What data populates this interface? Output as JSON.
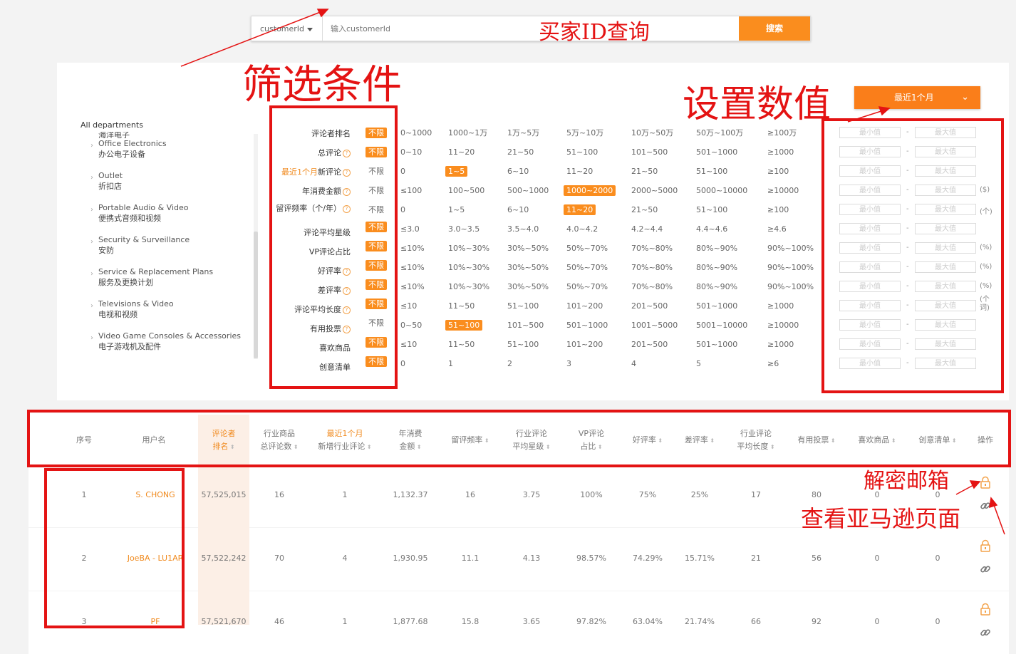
{
  "search": {
    "field_select": "customerId",
    "placeholder": "输入customerId",
    "button": "搜索"
  },
  "departments": {
    "title": "All departments",
    "partial_item": "海洋电子",
    "items": [
      {
        "en": "Office Electronics",
        "zh": "办公电子设备"
      },
      {
        "en": "Outlet",
        "zh": "折扣店"
      },
      {
        "en": "Portable Audio & Video",
        "zh": "便携式音频和视频"
      },
      {
        "en": "Security & Surveillance",
        "zh": "安防"
      },
      {
        "en": "Service & Replacement Plans",
        "zh": "服务及更换计划"
      },
      {
        "en": "Televisions & Video",
        "zh": "电视和视频"
      },
      {
        "en": "Video Game Consoles & Accessories",
        "zh": "电子游戏机及配件"
      }
    ]
  },
  "period_button": "最近1个月",
  "filters": [
    {
      "label": "评论者排名",
      "help": false,
      "nolimit": "不限",
      "nolimit_active": true,
      "options": [
        "0~1000",
        "1000~1万",
        "1万~5万",
        "5万~10万",
        "10万~50万",
        "50万~100万",
        "≥100万"
      ],
      "active": -1,
      "unit": ""
    },
    {
      "label": "总评论",
      "help": true,
      "nolimit": "不限",
      "nolimit_active": true,
      "options": [
        "0~10",
        "11~20",
        "21~50",
        "51~100",
        "101~500",
        "501~1000",
        "≥1000"
      ],
      "active": -1,
      "unit": ""
    },
    {
      "label_prefix": "最近1个月",
      "label": "新评论",
      "help": true,
      "nolimit": "不限",
      "nolimit_active": false,
      "options": [
        "0",
        "1~5",
        "6~10",
        "11~20",
        "21~50",
        "51~100",
        "≥100"
      ],
      "active": 1,
      "unit": ""
    },
    {
      "label": "年消费金额",
      "help": true,
      "nolimit": "不限",
      "nolimit_active": false,
      "options": [
        "≤100",
        "100~500",
        "500~1000",
        "1000~2000",
        "2000~5000",
        "5000~10000",
        "≥10000"
      ],
      "active": 3,
      "unit": "($)"
    },
    {
      "label": "留评频率（个/年）",
      "help": true,
      "nolimit": "不限",
      "nolimit_active": false,
      "options": [
        "0",
        "1~5",
        "6~10",
        "11~20",
        "21~50",
        "51~100",
        "≥100"
      ],
      "active": 3,
      "unit": "(个)"
    },
    {
      "label": "评论平均星级",
      "help": false,
      "nolimit": "不限",
      "nolimit_active": true,
      "options": [
        "≤3.0",
        "3.0~3.5",
        "3.5~4.0",
        "4.0~4.2",
        "4.2~4.4",
        "4.4~4.6",
        "≥4.6"
      ],
      "active": -1,
      "unit": ""
    },
    {
      "label": "VP评论占比",
      "help": false,
      "nolimit": "不限",
      "nolimit_active": true,
      "options": [
        "≤10%",
        "10%~30%",
        "30%~50%",
        "50%~70%",
        "70%~80%",
        "80%~90%",
        "90%~100%"
      ],
      "active": -1,
      "unit": "(%)"
    },
    {
      "label": "好评率",
      "help": true,
      "nolimit": "不限",
      "nolimit_active": true,
      "options": [
        "≤10%",
        "10%~30%",
        "30%~50%",
        "50%~70%",
        "70%~80%",
        "80%~90%",
        "90%~100%"
      ],
      "active": -1,
      "unit": "(%)"
    },
    {
      "label": "差评率",
      "help": true,
      "nolimit": "不限",
      "nolimit_active": true,
      "options": [
        "≤10%",
        "10%~30%",
        "30%~50%",
        "50%~70%",
        "70%~80%",
        "80%~90%",
        "90%~100%"
      ],
      "active": -1,
      "unit": "(%)"
    },
    {
      "label": "评论平均长度",
      "help": true,
      "nolimit": "不限",
      "nolimit_active": true,
      "options": [
        "≤10",
        "11~50",
        "51~100",
        "101~200",
        "201~500",
        "501~1000",
        "≥1000"
      ],
      "active": -1,
      "unit": "(个词)"
    },
    {
      "label": "有用投票",
      "help": true,
      "nolimit": "不限",
      "nolimit_active": false,
      "options": [
        "0~50",
        "51~100",
        "101~500",
        "501~1000",
        "1001~5000",
        "5001~10000",
        "≥10000"
      ],
      "active": 1,
      "unit": ""
    },
    {
      "label": "喜欢商品",
      "help": false,
      "nolimit": "不限",
      "nolimit_active": true,
      "options": [
        "≤10",
        "11~50",
        "51~100",
        "101~200",
        "201~500",
        "501~1000",
        "≥1000"
      ],
      "active": -1,
      "unit": ""
    },
    {
      "label": "创意清单",
      "help": false,
      "nolimit": "不限",
      "nolimit_active": true,
      "options": [
        "0",
        "1",
        "2",
        "3",
        "4",
        "5",
        "≥6"
      ],
      "active": -1,
      "unit": ""
    }
  ],
  "range": {
    "min": "最小值",
    "sep": "-",
    "max": "最大值"
  },
  "table": {
    "headers": [
      {
        "l1": "序号",
        "l2": "",
        "orange": false,
        "sort": false
      },
      {
        "l1": "用户名",
        "l2": "",
        "orange": false,
        "sort": false
      },
      {
        "l1": "评论者",
        "l2": "排名",
        "orange": true,
        "sort": true
      },
      {
        "l1": "行业商品",
        "l2": "总评论数",
        "orange": false,
        "sort": true
      },
      {
        "l1": "最近1个月",
        "l2": "新增行业评论",
        "orange": false,
        "sort": true,
        "l1_orange": true
      },
      {
        "l1": "年消费",
        "l2": "金额",
        "orange": false,
        "sort": true
      },
      {
        "l1": "留评频率",
        "l2": "",
        "orange": false,
        "sort": true
      },
      {
        "l1": "行业评论",
        "l2": "平均星级",
        "orange": false,
        "sort": true
      },
      {
        "l1": "VP评论",
        "l2": "占比",
        "orange": false,
        "sort": true
      },
      {
        "l1": "好评率",
        "l2": "",
        "orange": false,
        "sort": true
      },
      {
        "l1": "差评率",
        "l2": "",
        "orange": false,
        "sort": true
      },
      {
        "l1": "行业评论",
        "l2": "平均长度",
        "orange": false,
        "sort": true
      },
      {
        "l1": "有用投票",
        "l2": "",
        "orange": false,
        "sort": true
      },
      {
        "l1": "喜欢商品",
        "l2": "",
        "orange": false,
        "sort": true
      },
      {
        "l1": "创意清单",
        "l2": "",
        "orange": false,
        "sort": true
      },
      {
        "l1": "操作",
        "l2": "",
        "orange": false,
        "sort": false
      }
    ],
    "rows": [
      [
        "1",
        "S. CHONG",
        "57,525,015",
        "16",
        "1",
        "1,132.37",
        "16",
        "3.75",
        "100%",
        "75%",
        "25%",
        "17",
        "80",
        "0",
        "0"
      ],
      [
        "2",
        "JoeBA - LU1AR",
        "57,522,242",
        "70",
        "4",
        "1,930.95",
        "11.1",
        "4.13",
        "98.57%",
        "74.29%",
        "15.71%",
        "21",
        "56",
        "0",
        "0"
      ],
      [
        "3",
        "PF",
        "57,521,670",
        "46",
        "1",
        "1,877.68",
        "15.8",
        "3.65",
        "97.82%",
        "63.04%",
        "21.74%",
        "66",
        "92",
        "0",
        "0"
      ]
    ]
  },
  "annotations": {
    "buyer_id": "买家ID查询",
    "filters": "筛选条件",
    "set_values": "设置数值",
    "unlock_email": "解密邮箱",
    "amazon_page": "查看亚马逊页面"
  },
  "colors": {
    "accent": "#fa8d1e",
    "annotation": "#e41313"
  }
}
